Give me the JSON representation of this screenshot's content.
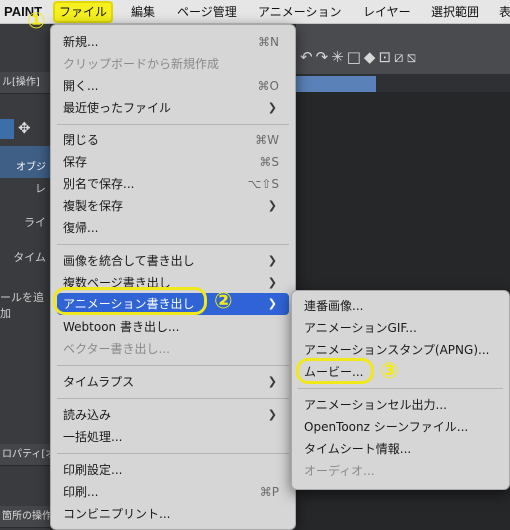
{
  "menubar": {
    "app_name": "PAINT",
    "items": [
      "ファイル",
      "編集",
      "ページ管理",
      "アニメーション",
      "レイヤー",
      "選択範囲",
      "表"
    ]
  },
  "background": {
    "panel_labels": [
      "ル[操作]",
      "オブジ",
      "レ",
      "ライ",
      "タイム",
      "ールを追加",
      "ロパティ[オ",
      "箇所の操作"
    ],
    "tool_label": "レ"
  },
  "file_menu": {
    "items": [
      {
        "label": "新規...",
        "shortcut": "⌘N"
      },
      {
        "label": "クリップボードから新規作成",
        "disabled": true
      },
      {
        "label": "開く...",
        "shortcut": "⌘O"
      },
      {
        "label": "最近使ったファイル"
      },
      {
        "label": "閉じる",
        "shortcut": "⌘W"
      },
      {
        "label": "保存",
        "shortcut": "⌘S"
      },
      {
        "label": "別名で保存...",
        "shortcut": "⌥⇧S"
      },
      {
        "label": "複製を保存"
      },
      {
        "label": "復帰..."
      },
      {
        "label": "画像を統合して書き出し"
      },
      {
        "label": "複数ページ書き出し"
      },
      {
        "label": "アニメーション書き出し"
      },
      {
        "label": "Webtoon 書き出し..."
      },
      {
        "label": "ベクター書き出し...",
        "disabled": true
      },
      {
        "label": "タイムラプス"
      },
      {
        "label": "読み込み"
      },
      {
        "label": "一括処理..."
      },
      {
        "label": "印刷設定..."
      },
      {
        "label": "印刷...",
        "shortcut": "⌘P"
      },
      {
        "label": "コンビニプリント..."
      }
    ]
  },
  "submenu": {
    "items": [
      {
        "label": "連番画像..."
      },
      {
        "label": "アニメーションGIF..."
      },
      {
        "label": "アニメーションスタンプ(APNG)..."
      },
      {
        "label": "ムービー..."
      },
      {
        "label": "アニメーションセル出力..."
      },
      {
        "label": "OpenToonz シーンファイル..."
      },
      {
        "label": "タイムシート情報..."
      },
      {
        "label": "オーディオ...",
        "disabled": true
      }
    ]
  },
  "annotations": {
    "step1": "①",
    "step2": "②",
    "step3": "③"
  },
  "colors": {
    "highlight": "#2f63d6",
    "annotation": "#f0e81a"
  }
}
